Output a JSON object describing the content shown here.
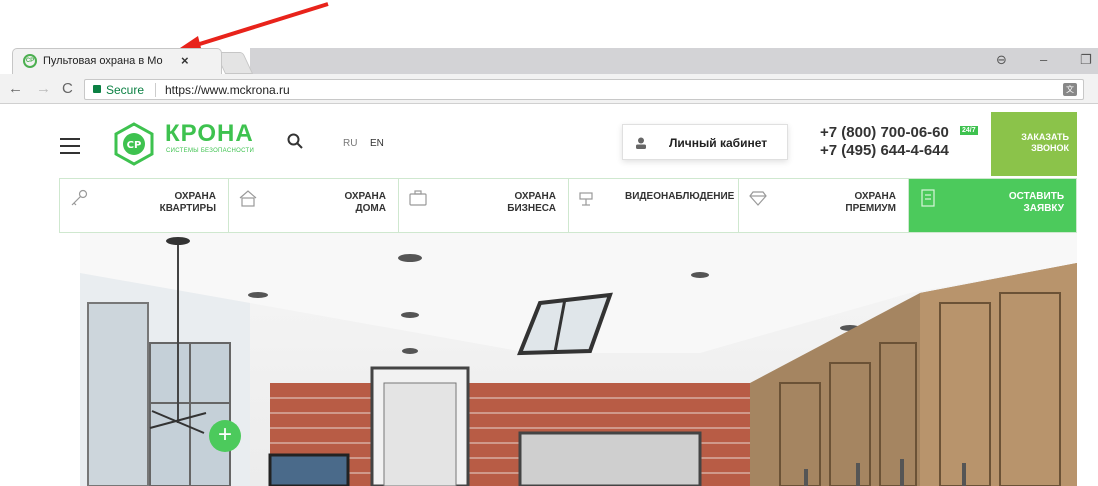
{
  "browser": {
    "tab_title": "Пультовая охрана в Мо",
    "tab_close": "×",
    "secure_label": "Secure",
    "url": "https://www.mckrona.ru",
    "nav_back": "←",
    "nav_forward": "→",
    "nav_reload": "C",
    "window_min": "–",
    "window_restore": "❐",
    "profile": "⊖"
  },
  "header": {
    "logo_mark_text": "CP",
    "logo_name": "КРОНА",
    "logo_tagline": "СИСТЕМЫ БЕЗОПАСНОСТИ",
    "lang_ru": "RU",
    "lang_en": "EN",
    "cabinet_label": "Личный кабинет",
    "phone_primary": "+7 (800) 700-06-60",
    "badge_247": "24/7",
    "phone_secondary": "+7 (495) 644-4-644",
    "callback_label": "ЗАКАЗАТЬ ЗВОНОК"
  },
  "nav": [
    {
      "label": "ОХРАНА\nКВАРТИРЫ",
      "icon": "key-icon"
    },
    {
      "label": "ОХРАНА\nДОМА",
      "icon": "house-icon"
    },
    {
      "label": "ОХРАНА\nБИЗНЕСА",
      "icon": "briefcase-icon"
    },
    {
      "label": "ВИДЕОНАБЛЮДЕНИЕ",
      "icon": "camera-icon"
    },
    {
      "label": "ОХРАНА\nПРЕМИУМ",
      "icon": "diamond-icon"
    },
    {
      "label": "ОСТАВИТЬ\nЗАЯВКУ",
      "icon": "document-icon"
    }
  ],
  "hero": {
    "plus": "+"
  },
  "colors": {
    "brand_green": "#3ec24f",
    "cta_green": "#4cca5c",
    "callback_green": "#8bc34a",
    "arrow_red": "#e8231b"
  }
}
